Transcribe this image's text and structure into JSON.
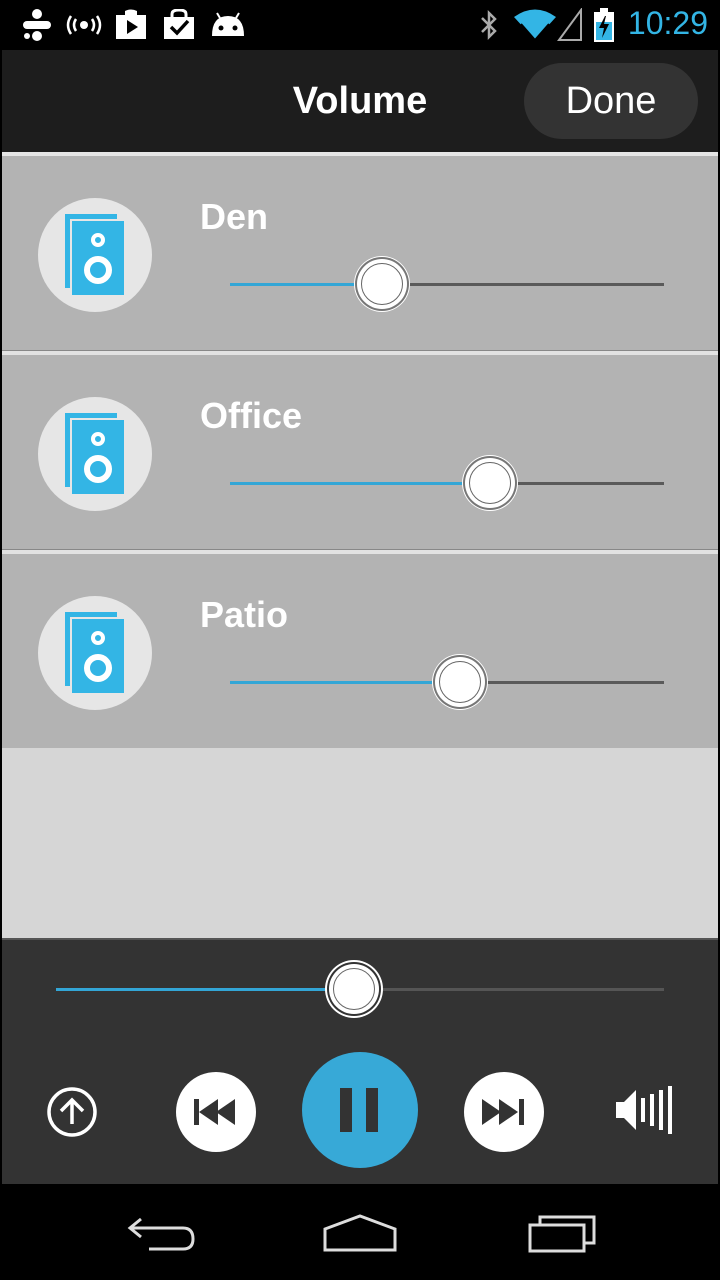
{
  "status_bar": {
    "time": "10:29",
    "icons": [
      "app-icon",
      "radio-icon",
      "play-store-icon",
      "shopping-bag-icon",
      "android-icon",
      "bluetooth-icon",
      "wifi-icon",
      "signal-icon",
      "battery-charging-icon"
    ]
  },
  "header": {
    "title": "Volume",
    "done_label": "Done"
  },
  "zones": [
    {
      "name": "Den",
      "icon": "speaker-icon",
      "volume": 0.35
    },
    {
      "name": "Office",
      "icon": "speaker-icon",
      "volume": 0.6
    },
    {
      "name": "Patio",
      "icon": "speaker-icon",
      "volume": 0.53
    }
  ],
  "player": {
    "master_volume": 0.49,
    "controls": [
      "upload-icon",
      "previous-icon",
      "pause-icon",
      "next-icon",
      "volume-icon"
    ]
  },
  "nav_bar": {
    "buttons": [
      "back-icon",
      "home-icon",
      "recents-icon"
    ]
  },
  "colors": {
    "accent": "#33b5e5",
    "slider_fill": "#33a6d6",
    "zone_bg": "#b3b3b3",
    "header_bg": "#1d1d1d",
    "player_bg": "#333333"
  }
}
